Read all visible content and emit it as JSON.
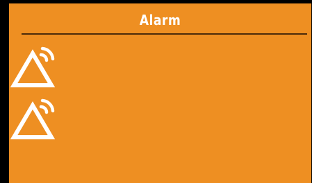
{
  "header": {
    "title": "Alarm"
  },
  "alarms": [
    {
      "icon": "alarm-warning-icon"
    },
    {
      "icon": "alarm-warning-icon"
    }
  ],
  "colors": {
    "background": "#ee8f22",
    "icon": "#ffffff",
    "divider": "#4a2a0a",
    "frame": "#000000"
  }
}
